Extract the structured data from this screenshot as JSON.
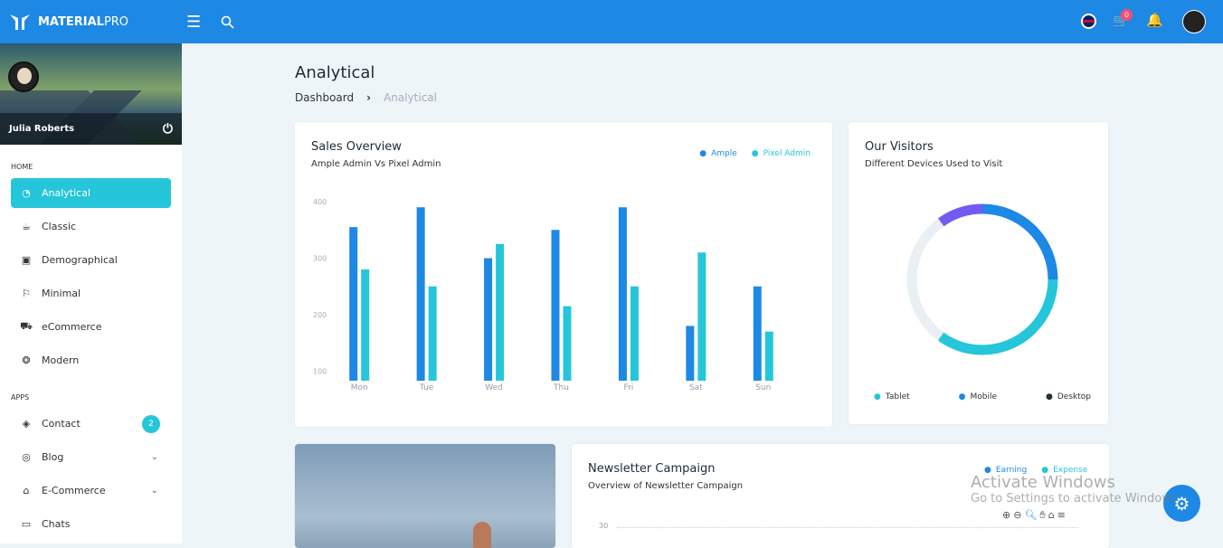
{
  "brand": {
    "bold": "MATERIAL",
    "light": "PRO"
  },
  "topbar": {
    "cart_count": "0"
  },
  "user": {
    "name": "Julia Roberts"
  },
  "sidebar": {
    "home_label": "HOME",
    "apps_label": "APPS",
    "home_items": [
      {
        "label": "Analytical",
        "icon": "pie-chart-icon"
      },
      {
        "label": "Classic",
        "icon": "cup-icon"
      },
      {
        "label": "Demographical",
        "icon": "cpu-icon"
      },
      {
        "label": "Minimal",
        "icon": "flag-icon"
      },
      {
        "label": "eCommerce",
        "icon": "cart-icon"
      },
      {
        "label": "Modern",
        "icon": "aperture-icon"
      }
    ],
    "app_items": [
      {
        "label": "Contact",
        "badge": "2"
      },
      {
        "label": "Blog"
      },
      {
        "label": "E-Commerce"
      },
      {
        "label": "Chats"
      }
    ]
  },
  "page": {
    "title": "Analytical",
    "breadcrumb": [
      "Dashboard",
      "Analytical"
    ]
  },
  "sales": {
    "title": "Sales Overview",
    "subtitle": "Ample Admin Vs Pixel Admin",
    "legend": [
      "Ample",
      "Pixel Admin"
    ]
  },
  "visitors": {
    "title": "Our Visitors",
    "subtitle": "Different Devices Used to Visit",
    "legend": [
      "Tablet",
      "Mobile",
      "Desktop"
    ],
    "values": {
      "Tablet": 35,
      "Mobile": 25,
      "Desktop": 10,
      "Other": 30
    }
  },
  "newsletter": {
    "title": "Newsletter Campaign",
    "subtitle": "Overview of Newsletter Campaign",
    "legend": [
      "Earning",
      "Expense"
    ],
    "ytick": "30"
  },
  "watermark": {
    "title": "Activate Windows",
    "sub": "Go to Settings to activate Windows."
  },
  "colors": {
    "primary": "#1e88e5",
    "accent": "#26c6da",
    "purple": "#745af2"
  },
  "chart_data": {
    "type": "bar",
    "categories": [
      "Mon",
      "Tue",
      "Wed",
      "Thu",
      "Fri",
      "Sat",
      "Sun"
    ],
    "series": [
      {
        "name": "Ample",
        "values": [
          355,
          390,
          300,
          350,
          390,
          180,
          250
        ]
      },
      {
        "name": "Pixel Admin",
        "values": [
          280,
          250,
          325,
          215,
          250,
          310,
          170
        ]
      }
    ],
    "yticks": [
      "100",
      "200",
      "300",
      "400"
    ],
    "ylim": [
      83,
      400
    ]
  }
}
